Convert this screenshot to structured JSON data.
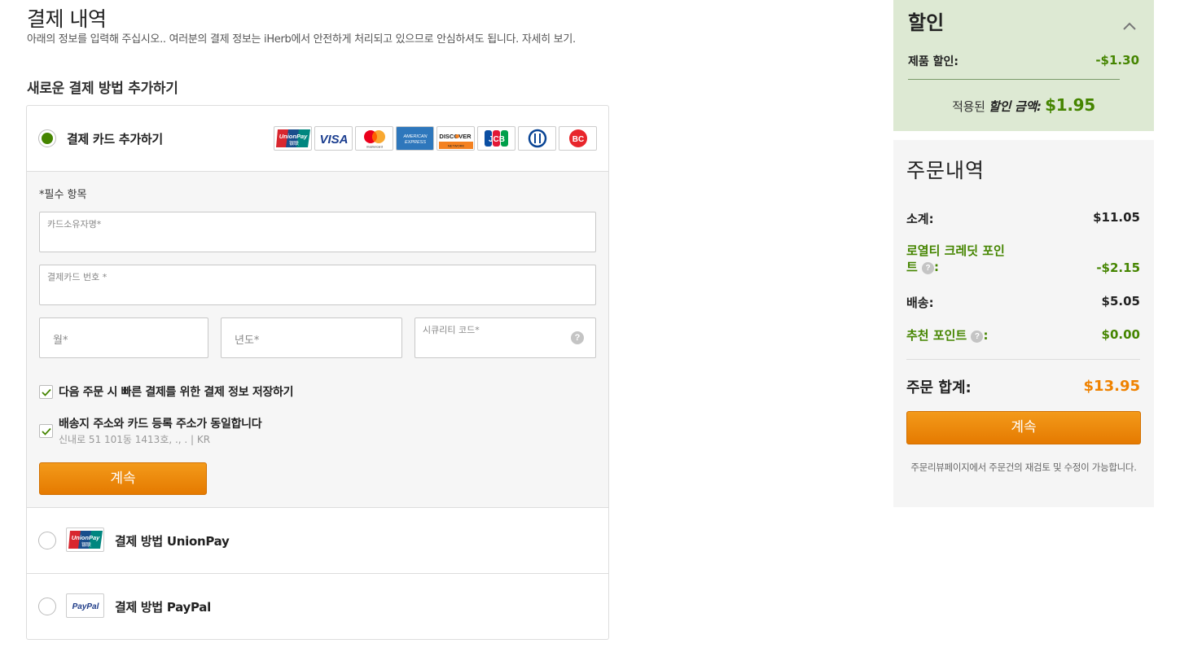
{
  "header": {
    "title": "결제 내역",
    "subtitle": "아래의 정보를 입력해 주십시오.. 여러분의 결제 정보는 iHerb에서 안전하게 처리되고 있으므로 안심하셔도 됩니다. 자세히 보기.",
    "section_title": "새로운 결제 방법 추가하기"
  },
  "card_method": {
    "label": "결제 카드 추가하기",
    "selected": true,
    "logos": [
      "unionpay-logo",
      "visa-logo",
      "mastercard-logo",
      "amex-logo",
      "discover-logo",
      "jcb-logo",
      "diners-logo",
      "bc-logo"
    ],
    "logo_text": {
      "unionpay": "UnionPay",
      "unionpay_sub": "银联",
      "visa": "VISA",
      "mastercard": "mastercard",
      "amex_1": "AMERICAN",
      "amex_2": "EXPRESS",
      "discover": "DISCOVER",
      "discover_sub": "NETWORK",
      "jcb": "JCB",
      "bc": "BC"
    }
  },
  "form": {
    "required_note": "*필수 항목",
    "cardholder_label": "카드소유자명*",
    "card_number_label": "결제카드 번호 *",
    "month_placeholder": "월*",
    "year_placeholder": "년도*",
    "cvv_label": "시큐리티 코드*",
    "cvv_help": "?",
    "save_label": "다음 주문 시 빠른 결제를 위한 결제 정보 저장하기",
    "save_checked": true,
    "same_address_label": "배송지 주소와 카드 등록 주소가 동일합니다",
    "same_address_checked": true,
    "address": "신내로 51 101동 1413호, ., . | KR",
    "continue_label": "계속"
  },
  "other_methods": [
    {
      "label": "결제 방법 UnionPay",
      "logo": "unionpay-logo",
      "selected": false
    },
    {
      "label": "결제 방법 PayPal",
      "logo": "paypal-logo",
      "logo_text": "PayPal",
      "selected": false
    }
  ],
  "discount": {
    "title": "할인",
    "product_discount_label": "제품 할인:",
    "product_discount_value": "-$1.30",
    "applied_prefix": "적용된",
    "applied_italic": "할인 금액:",
    "applied_amount": "$1.95"
  },
  "order": {
    "title": "주문내역",
    "subtotal_label": "소계:",
    "subtotal_value": "$11.05",
    "loyalty_label_1": "로열티 크레딧 포인",
    "loyalty_label_2": "트",
    "loyalty_value": "-$2.15",
    "shipping_label": "배송:",
    "shipping_value": "$5.05",
    "referral_label": "추천 포인트",
    "referral_value": "$0.00",
    "total_label": "주문 합계:",
    "total_value": "$13.95",
    "continue_label": "계속",
    "note": "주문리뷰페이지에서 주문건의 재검토 및 수정이 가능합니다."
  },
  "colors": {
    "accent_green": "#458500",
    "accent_orange": "#ef8200",
    "discount_bg": "#dde9d3"
  }
}
